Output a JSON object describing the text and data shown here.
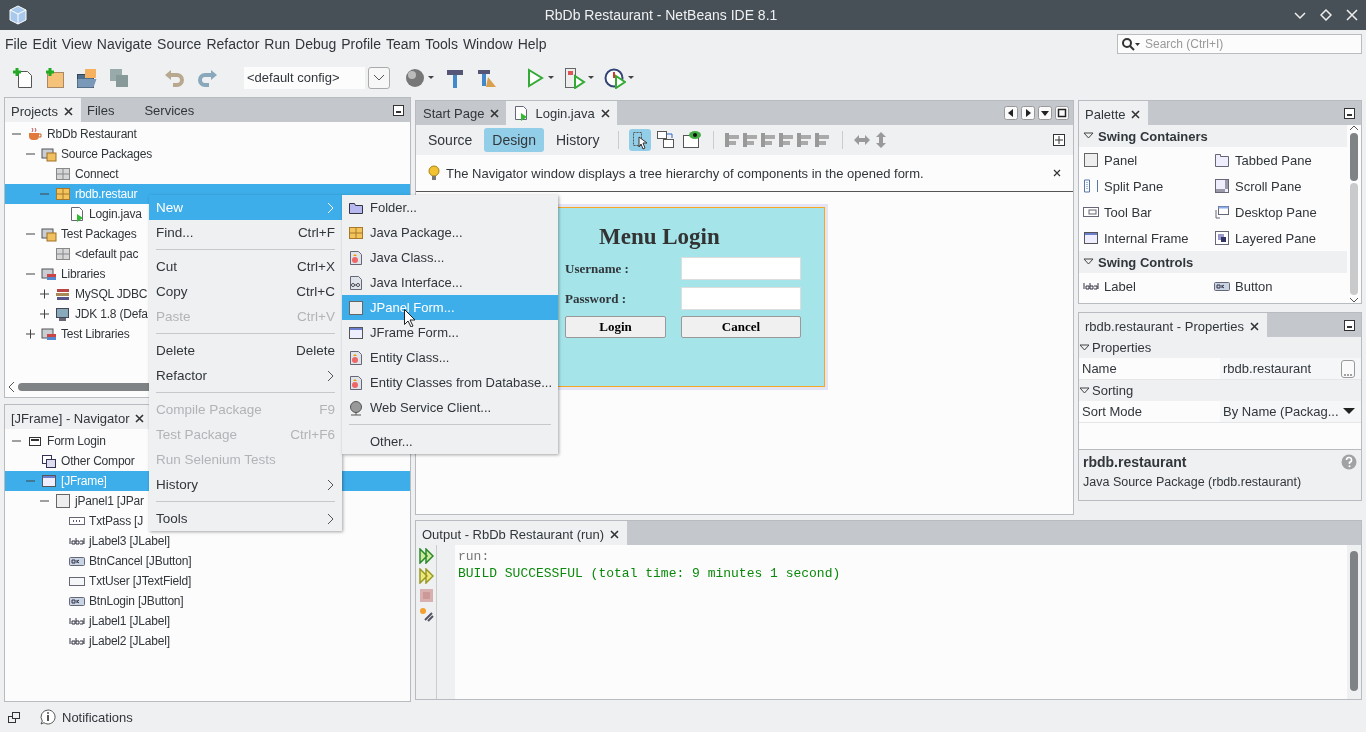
{
  "window": {
    "title": "RbDb Restaurant - NetBeans IDE 8.1"
  },
  "menu_bar": [
    "File",
    "Edit",
    "View",
    "Navigate",
    "Source",
    "Refactor",
    "Run",
    "Debug",
    "Profile",
    "Team",
    "Tools",
    "Window",
    "Help"
  ],
  "search": {
    "placeholder": "Search (Ctrl+I)"
  },
  "toolbar": {
    "config": "<default config>"
  },
  "projects_panel": {
    "tabs": [
      {
        "label": "Projects",
        "selected": true
      },
      {
        "label": "Files",
        "selected": false
      },
      {
        "label": "Services",
        "selected": false
      }
    ],
    "tree": [
      {
        "label": "RbDb Restaurant",
        "kind": "project",
        "expanded": true,
        "selected": false,
        "children": [
          {
            "label": "Source Packages",
            "kind": "packages",
            "expanded": true,
            "selected": false,
            "children": [
              {
                "label": "Connect",
                "kind": "package-empty",
                "selected": false
              },
              {
                "label": "rbdb.restaur",
                "kind": "package",
                "expanded": true,
                "selected": true,
                "children": [
                  {
                    "label": "Login.java",
                    "kind": "java-file",
                    "selected": false
                  }
                ]
              }
            ]
          },
          {
            "label": "Test Packages",
            "kind": "packages",
            "expanded": true,
            "selected": false,
            "children": [
              {
                "label": "<default pac",
                "kind": "package-empty",
                "selected": false
              }
            ]
          },
          {
            "label": "Libraries",
            "kind": "libraries",
            "expanded": true,
            "selected": false,
            "children": [
              {
                "label": "MySQL JDBC",
                "kind": "jar",
                "expanded": false,
                "selected": false
              },
              {
                "label": "JDK 1.8 (Defa",
                "kind": "jdk",
                "expanded": false,
                "selected": false
              }
            ]
          },
          {
            "label": "Test Libraries",
            "kind": "libraries",
            "expanded": false,
            "selected": false
          }
        ]
      }
    ]
  },
  "navigator_panel": {
    "title": "[JFrame] - Navigator",
    "tree": [
      {
        "label": "Form Login",
        "kind": "form",
        "expanded": true,
        "selected": false,
        "children": [
          {
            "label": "Other Compor",
            "kind": "other",
            "selected": false
          },
          {
            "label": "[JFrame]",
            "kind": "jframe",
            "expanded": true,
            "selected": true,
            "children": [
              {
                "label": "jPanel1 [JPar",
                "kind": "jpanel",
                "expanded": true,
                "selected": false,
                "children": [
                  {
                    "label": "TxtPass [J",
                    "kind": "password",
                    "selected": false
                  },
                  {
                    "label": "jLabel3 [JLabel]",
                    "kind": "label",
                    "selected": false
                  },
                  {
                    "label": "BtnCancel [JButton]",
                    "kind": "button",
                    "selected": false
                  },
                  {
                    "label": "TxtUser [JTextField]",
                    "kind": "textfield",
                    "selected": false
                  },
                  {
                    "label": "BtnLogin [JButton]",
                    "kind": "button",
                    "selected": false
                  },
                  {
                    "label": "jLabel1 [JLabel]",
                    "kind": "label",
                    "selected": false
                  },
                  {
                    "label": "jLabel2 [JLabel]",
                    "kind": "label",
                    "selected": false
                  }
                ]
              }
            ]
          }
        ]
      }
    ]
  },
  "editor": {
    "tabs": [
      {
        "label": "Start Page",
        "selected": false
      },
      {
        "label": "Login.java",
        "selected": true
      }
    ],
    "view_tabs": [
      {
        "label": "Source",
        "selected": false
      },
      {
        "label": "Design",
        "selected": true
      },
      {
        "label": "History",
        "selected": false
      }
    ],
    "hint": "The Navigator window displays a tree hierarchy of components in the opened form.",
    "form": {
      "title": "Menu Login",
      "fields": [
        {
          "label": "Username :"
        },
        {
          "label": "Password :"
        }
      ],
      "buttons": [
        "Login",
        "Cancel"
      ]
    }
  },
  "palette": {
    "title": "Palette",
    "sections": [
      {
        "title": "Swing Containers",
        "expanded": true,
        "items": [
          {
            "label": "Panel",
            "kind": "panel"
          },
          {
            "label": "Tabbed Pane",
            "kind": "tabbed"
          },
          {
            "label": "Split Pane",
            "kind": "split"
          },
          {
            "label": "Scroll Pane",
            "kind": "scroll"
          },
          {
            "label": "Tool Bar",
            "kind": "toolbar"
          },
          {
            "label": "Desktop Pane",
            "kind": "desktop"
          },
          {
            "label": "Internal Frame",
            "kind": "iframe"
          },
          {
            "label": "Layered Pane",
            "kind": "layered"
          }
        ]
      },
      {
        "title": "Swing Controls",
        "expanded": true,
        "items": [
          {
            "label": "Label",
            "kind": "label"
          },
          {
            "label": "Button",
            "kind": "button"
          }
        ]
      }
    ]
  },
  "properties": {
    "title": "rbdb.restaurant - Properties",
    "sections": [
      {
        "title": "Properties",
        "expanded": true,
        "rows": [
          {
            "name": "Name",
            "value": "rbdb.restaurant",
            "kind": "text"
          }
        ]
      },
      {
        "title": "Sorting",
        "expanded": true,
        "rows": [
          {
            "name": "Sort Mode",
            "value": "By Name (Packag...",
            "kind": "dropdown"
          }
        ]
      }
    ],
    "description_title": "rbdb.restaurant",
    "description": "Java Source Package (rbdb.restaurant)"
  },
  "output": {
    "title": "Output - RbDb Restaurant (run)",
    "lines": [
      {
        "text": "run:",
        "kind": "plain"
      },
      {
        "text": "BUILD SUCCESSFUL (total time: 9 minutes 1 second)",
        "kind": "success"
      }
    ]
  },
  "context_menu": [
    {
      "kind": "item",
      "label": "New",
      "submenu": true,
      "selected": true,
      "disabled": false
    },
    {
      "kind": "item",
      "label": "Find...",
      "shortcut": "Ctrl+F",
      "submenu": false,
      "selected": false,
      "disabled": false
    },
    {
      "kind": "separator"
    },
    {
      "kind": "item",
      "label": "Cut",
      "shortcut": "Ctrl+X",
      "submenu": false,
      "selected": false,
      "disabled": false
    },
    {
      "kind": "item",
      "label": "Copy",
      "shortcut": "Ctrl+C",
      "submenu": false,
      "selected": false,
      "disabled": false
    },
    {
      "kind": "item",
      "label": "Paste",
      "shortcut": "Ctrl+V",
      "submenu": false,
      "selected": false,
      "disabled": true
    },
    {
      "kind": "separator"
    },
    {
      "kind": "item",
      "label": "Delete",
      "shortcut": "Delete",
      "submenu": false,
      "selected": false,
      "disabled": false
    },
    {
      "kind": "item",
      "label": "Refactor",
      "submenu": true,
      "selected": false,
      "disabled": false
    },
    {
      "kind": "separator"
    },
    {
      "kind": "item",
      "label": "Compile Package",
      "shortcut": "F9",
      "submenu": false,
      "selected": false,
      "disabled": true
    },
    {
      "kind": "item",
      "label": "Test Package",
      "shortcut": "Ctrl+F6",
      "submenu": false,
      "selected": false,
      "disabled": true
    },
    {
      "kind": "item",
      "label": "Run Selenium Tests",
      "submenu": false,
      "selected": false,
      "disabled": true
    },
    {
      "kind": "item",
      "label": "History",
      "submenu": true,
      "selected": false,
      "disabled": false
    },
    {
      "kind": "separator"
    },
    {
      "kind": "item",
      "label": "Tools",
      "submenu": true,
      "selected": false,
      "disabled": false
    }
  ],
  "submenu": [
    {
      "kind": "folder",
      "label": "Folder...",
      "selected": false
    },
    {
      "kind": "package",
      "label": "Java Package...",
      "selected": false
    },
    {
      "kind": "class",
      "label": "Java Class...",
      "selected": false
    },
    {
      "kind": "interface",
      "label": "Java Interface...",
      "selected": false
    },
    {
      "kind": "jpanel",
      "label": "JPanel Form...",
      "selected": true
    },
    {
      "kind": "jframe",
      "label": "JFrame Form...",
      "selected": false
    },
    {
      "kind": "class",
      "label": "Entity Class...",
      "selected": false
    },
    {
      "kind": "class",
      "label": "Entity Classes from Database...",
      "selected": false
    },
    {
      "kind": "web",
      "label": "Web Service Client...",
      "selected": false
    },
    {
      "kind": "separator"
    },
    {
      "kind": "plain",
      "label": "Other...",
      "selected": false
    }
  ],
  "status_bar": {
    "notifications": "Notifications"
  }
}
